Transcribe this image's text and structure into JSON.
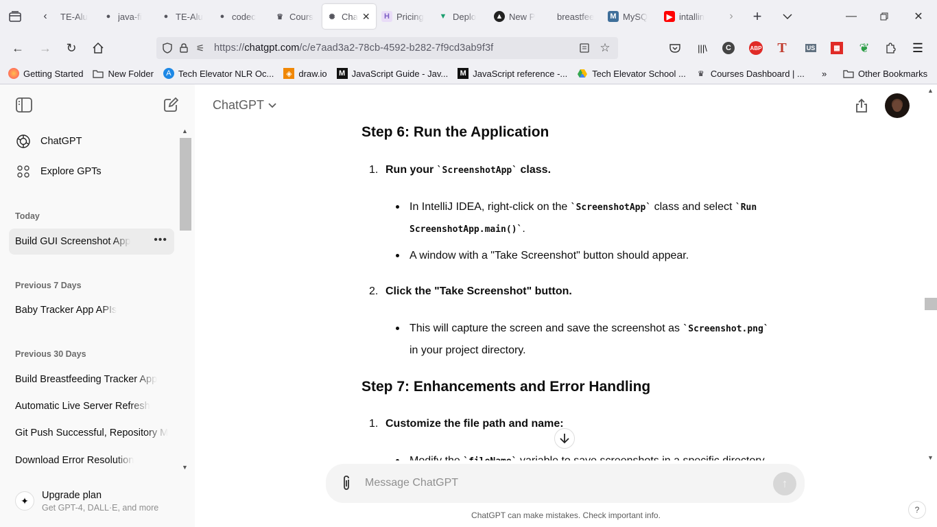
{
  "browser": {
    "tabs": [
      {
        "label": "TE-Alu",
        "favicon": "T",
        "favicon_color": "#f4f4f4"
      },
      {
        "label": "java-fi",
        "favicon": "github-icon",
        "favicon_color": "#24292f"
      },
      {
        "label": "TE-Alu",
        "favicon": "github-icon",
        "favicon_color": "#24292f"
      },
      {
        "label": "codec",
        "favicon": "github-icon",
        "favicon_color": "#24292f"
      },
      {
        "label": "Cours",
        "favicon": "crown-icon",
        "favicon_color": "#2b2b2b"
      },
      {
        "label": "Cha",
        "favicon": "openai-icon",
        "favicon_color": "#444"
      },
      {
        "label": "Pricing",
        "favicon": "H",
        "favicon_color": "#7b5cc4"
      },
      {
        "label": "Deplo",
        "favicon": "V",
        "favicon_color": "#1a9e6e"
      },
      {
        "label": "New P",
        "favicon": "A",
        "favicon_color": "#222"
      },
      {
        "label": "breastfee",
        "favicon": "",
        "favicon_color": "#ddd"
      },
      {
        "label": "MySQ",
        "favicon": "mysql-icon",
        "favicon_color": "#3f6f9a"
      },
      {
        "label": "intallin",
        "favicon": "youtube-icon",
        "favicon_color": "#ff0000"
      }
    ],
    "url_prefix": "https://",
    "url_host": "chatgpt.com",
    "url_path": "/c/e7aad3a2-78cb-4592-b282-7f9cd3ab9f3f",
    "bookmarks": [
      {
        "label": "Getting Started",
        "icon": "firefox-icon"
      },
      {
        "label": "New Folder",
        "icon": "folder-icon"
      },
      {
        "label": "Tech Elevator NLR Oc...",
        "icon": "tech-elevator-icon"
      },
      {
        "label": "draw.io",
        "icon": "drawio-icon"
      },
      {
        "label": "JavaScript Guide - Jav...",
        "icon": "mdn-icon"
      },
      {
        "label": "JavaScript reference -...",
        "icon": "mdn-icon"
      },
      {
        "label": "Tech Elevator School ...",
        "icon": "drive-icon"
      },
      {
        "label": "Courses Dashboard | ...",
        "icon": "crown-icon"
      }
    ],
    "other_bookmarks": "Other Bookmarks"
  },
  "sidebar": {
    "nav": [
      {
        "label": "ChatGPT",
        "icon": "openai-icon"
      },
      {
        "label": "Explore GPTs",
        "icon": "grid-icon"
      }
    ],
    "sections": [
      {
        "heading": "Today",
        "items": [
          "Build GUI Screenshot App"
        ]
      },
      {
        "heading": "Previous 7 Days",
        "items": [
          "Baby Tracker App APIs"
        ]
      },
      {
        "heading": "Previous 30 Days",
        "items": [
          "Build Breastfeeding Tracker App",
          "Automatic Live Server Refresh",
          "Git Push Successful, Repository M",
          "Download Error Resolution"
        ]
      }
    ],
    "upgrade_title": "Upgrade plan",
    "upgrade_subtitle": "Get GPT-4, DALL·E, and more"
  },
  "header": {
    "model": "ChatGPT"
  },
  "conversation": {
    "step6_title": "Step 6: Run the Application",
    "step6_item1_num": "1.",
    "step6_item1_pre": "Run your ",
    "step6_item1_code": "`ScreenshotApp`",
    "step6_item1_post": " class.",
    "step6_b1_pre": "In IntelliJ IDEA, right-click on the ",
    "step6_b1_code1": "`ScreenshotApp`",
    "step6_b1_mid": " class and select ",
    "step6_b1_code2a": "`Run",
    "step6_b1_code2b": "ScreenshotApp.main()`",
    "step6_b1_post": ".",
    "step6_b2": "A window with a \"Take Screenshot\" button should appear.",
    "step6_item2_num": "2.",
    "step6_item2": "Click the \"Take Screenshot\" button.",
    "step6_b3_pre": "This will capture the screen and save the screenshot as ",
    "step6_b3_code": "`Screenshot.png`",
    "step6_b3_post": "in your project directory.",
    "step7_title": "Step 7: Enhancements and Error Handling",
    "step7_item1_num": "1.",
    "step7_item1": "Customize the file path and name:",
    "step7_b1_pre": "Modify the ",
    "step7_b1_code": "`fileName`",
    "step7_b1_post": " variable to save screenshots in a specific directory"
  },
  "composer": {
    "placeholder": "Message ChatGPT"
  },
  "footer": {
    "disclaimer": "ChatGPT can make mistakes. Check important info.",
    "help": "?"
  }
}
